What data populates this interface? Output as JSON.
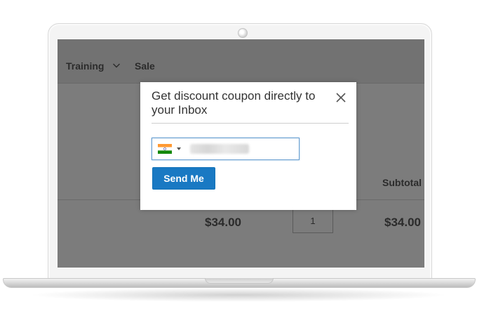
{
  "store": {
    "nav": {
      "training_label": "Training",
      "sale_label": "Sale"
    },
    "cart": {
      "subtotal_header": "Subtotal",
      "item_price": "$34.00",
      "item_qty": "1",
      "item_subtotal": "$34.00"
    }
  },
  "modal": {
    "title": "Get discount coupon directly to your Inbox",
    "close_icon": "close-icon",
    "phone": {
      "country_flag": "india-flag-icon",
      "value": "",
      "value_blurred": true
    },
    "send_label": "Send Me"
  },
  "colors": {
    "overlay": "#7c7c7c",
    "button": "#1979c3",
    "field_focus": "#6a9fd0"
  }
}
